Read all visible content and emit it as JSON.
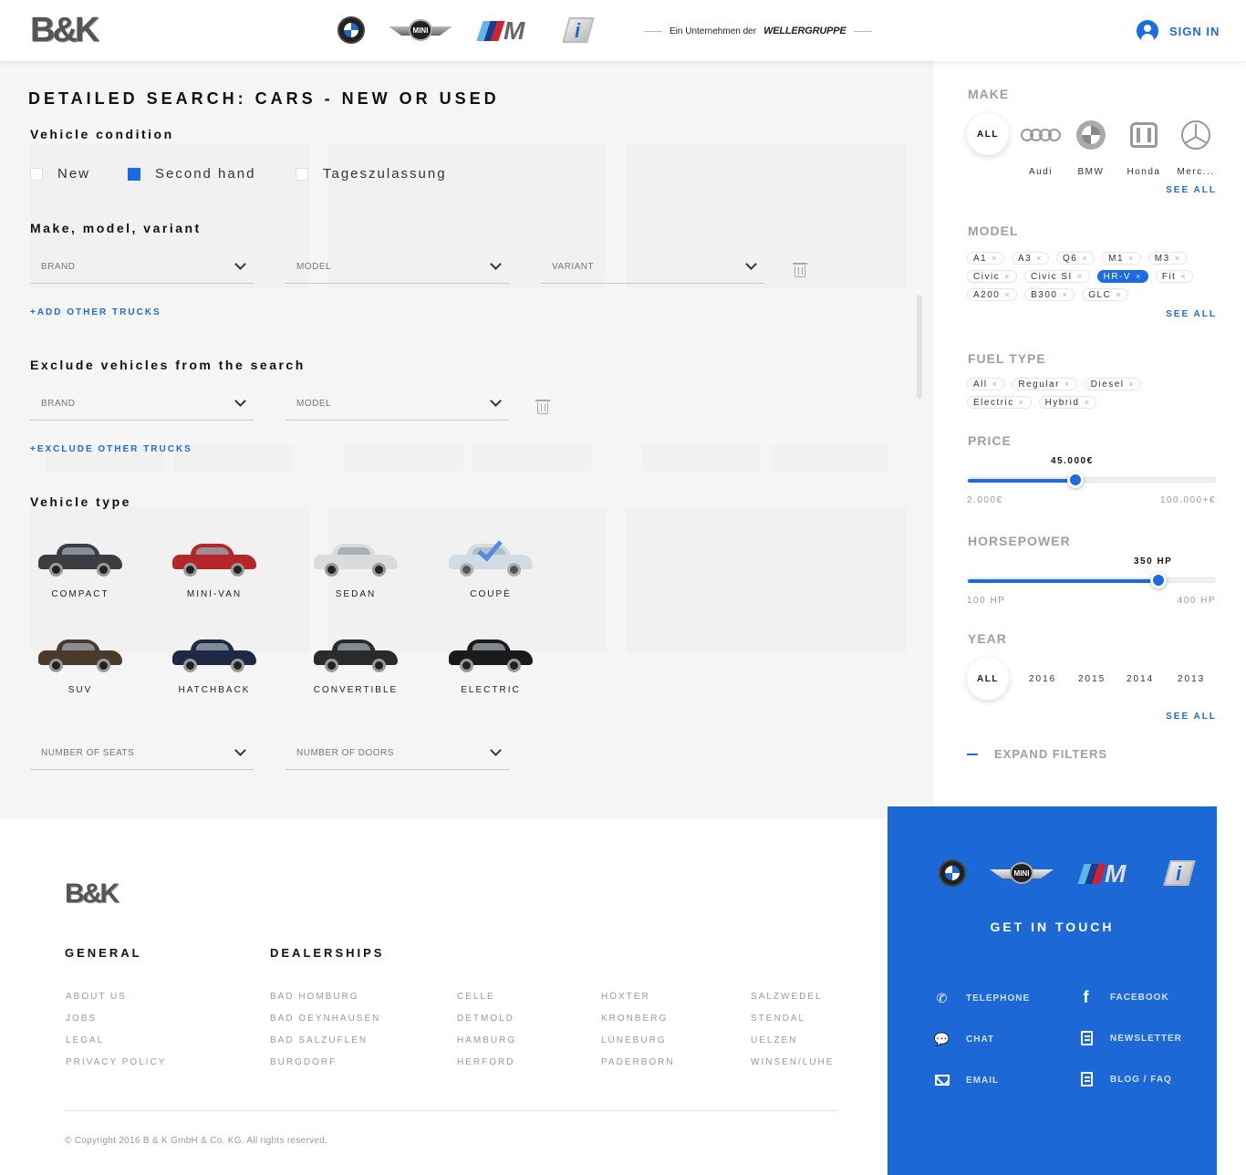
{
  "header": {
    "logo": "B&K",
    "brands": {
      "bmw": "bmw-logo",
      "mini_text": "MINI",
      "m": "M",
      "i": "i"
    },
    "company_prefix": "Ein Unternehmen der",
    "company_name": "WELLERGRUPPE",
    "sign_in": "SIGN IN"
  },
  "search": {
    "title": "DETAILED SEARCH: CARS - NEW OR USED",
    "condition": {
      "title": "Vehicle condition",
      "options": [
        {
          "label": "New",
          "checked": false
        },
        {
          "label": "Second hand",
          "checked": true
        },
        {
          "label": "Tageszulassung",
          "checked": false
        }
      ]
    },
    "make_model": {
      "title": "Make, model, variant",
      "brand_placeholder": "BRAND",
      "model_placeholder": "MODEL",
      "variant_placeholder": "VARIANT",
      "add_link": "+ADD OTHER TRUCKS"
    },
    "exclude": {
      "title": "Exclude vehicles from the search",
      "brand_placeholder": "BRAND",
      "model_placeholder": "MODEL",
      "add_link": "+EXCLUDE OTHER TRUCKS"
    },
    "vehicle_type": {
      "title": "Vehicle type",
      "types": [
        {
          "label": "COMPACT",
          "color": "#3a3d42",
          "selected": false
        },
        {
          "label": "MINI-VAN",
          "color": "#b3262b",
          "selected": false
        },
        {
          "label": "SEDAN",
          "color": "#d9dbde",
          "selected": false
        },
        {
          "label": "COUPÈ",
          "color": "#c9d4de",
          "selected": true
        },
        {
          "label": "SUV",
          "color": "#4a3a2c",
          "selected": false
        },
        {
          "label": "HATCHBACK",
          "color": "#1e2a45",
          "selected": false
        },
        {
          "label": "CONVERTIBLE",
          "color": "#2b2b2b",
          "selected": false
        },
        {
          "label": "ELECTRIC",
          "color": "#1a1a1a",
          "selected": false
        }
      ]
    },
    "seats_placeholder": "NUMBER OF SEATS",
    "doors_placeholder": "NUMBER OF DOORS"
  },
  "filters": {
    "make": {
      "title": "MAKE",
      "all": "ALL",
      "items": [
        "Audi",
        "BMW",
        "Honda",
        "Merc..."
      ],
      "see_all": "SEE ALL"
    },
    "model": {
      "title": "MODEL",
      "chips": [
        {
          "label": "A1",
          "selected": false
        },
        {
          "label": "A3",
          "selected": false
        },
        {
          "label": "Q6",
          "selected": false
        },
        {
          "label": "M1",
          "selected": false
        },
        {
          "label": "M3",
          "selected": false
        },
        {
          "label": "Civic",
          "selected": false
        },
        {
          "label": "Civic SI",
          "selected": false
        },
        {
          "label": "HR-V",
          "selected": true
        },
        {
          "label": "Fit",
          "selected": false
        },
        {
          "label": "A200",
          "selected": false
        },
        {
          "label": "B300",
          "selected": false
        },
        {
          "label": "GLC",
          "selected": false
        }
      ],
      "see_all": "SEE ALL"
    },
    "fuel": {
      "title": "FUEL TYPE",
      "chips": [
        "All",
        "Regular",
        "Diesel",
        "Electric",
        "Hybrid"
      ]
    },
    "price": {
      "title": "PRICE",
      "value": "45.000€",
      "min": "2.000€",
      "max": "100.000+€",
      "fraction": 0.434
    },
    "horsepower": {
      "title": "HORSEPOWER",
      "value": "350 HP",
      "min": "100 HP",
      "max": "400 HP",
      "fraction": 0.764
    },
    "year": {
      "title": "YEAR",
      "all": "ALL",
      "years": [
        "2016",
        "2015",
        "2014",
        "2013"
      ],
      "see_all": "SEE ALL"
    },
    "expand": "EXPAND FILTERS"
  },
  "footer": {
    "logo": "B&K",
    "general": {
      "title": "GENERAL",
      "links": [
        "ABOUT US",
        "JOBS",
        "LEGAL",
        "PRIVACY POLICY"
      ]
    },
    "dealerships": {
      "title": "DEALERSHIPS",
      "columns": [
        [
          "BAD HOMBURG",
          "BAD OEYNHAUSEN",
          "BAD SALZUFLEN",
          "BURGDORF"
        ],
        [
          "CELLE",
          "DETMOLD",
          "HAMBURG",
          "HERFORD"
        ],
        [
          "HÖXTER",
          "KRONBERG",
          "LÜNEBURG",
          "PADERBORN"
        ],
        [
          "SALZWEDEL",
          "STENDAL",
          "UELZEN",
          "WINSEN/LUHE"
        ]
      ]
    },
    "copyright": "© Copyright 2016 B & K GmbH & Co. KG. All rights reserved.",
    "contact": {
      "title": "GET IN TOUCH",
      "telephone": "TELEPHONE",
      "facebook": "FACEBOOK",
      "chat": "CHAT",
      "newsletter": "NEWSLETTER",
      "email": "EMAIL",
      "blog": "BLOG / FAQ"
    }
  }
}
